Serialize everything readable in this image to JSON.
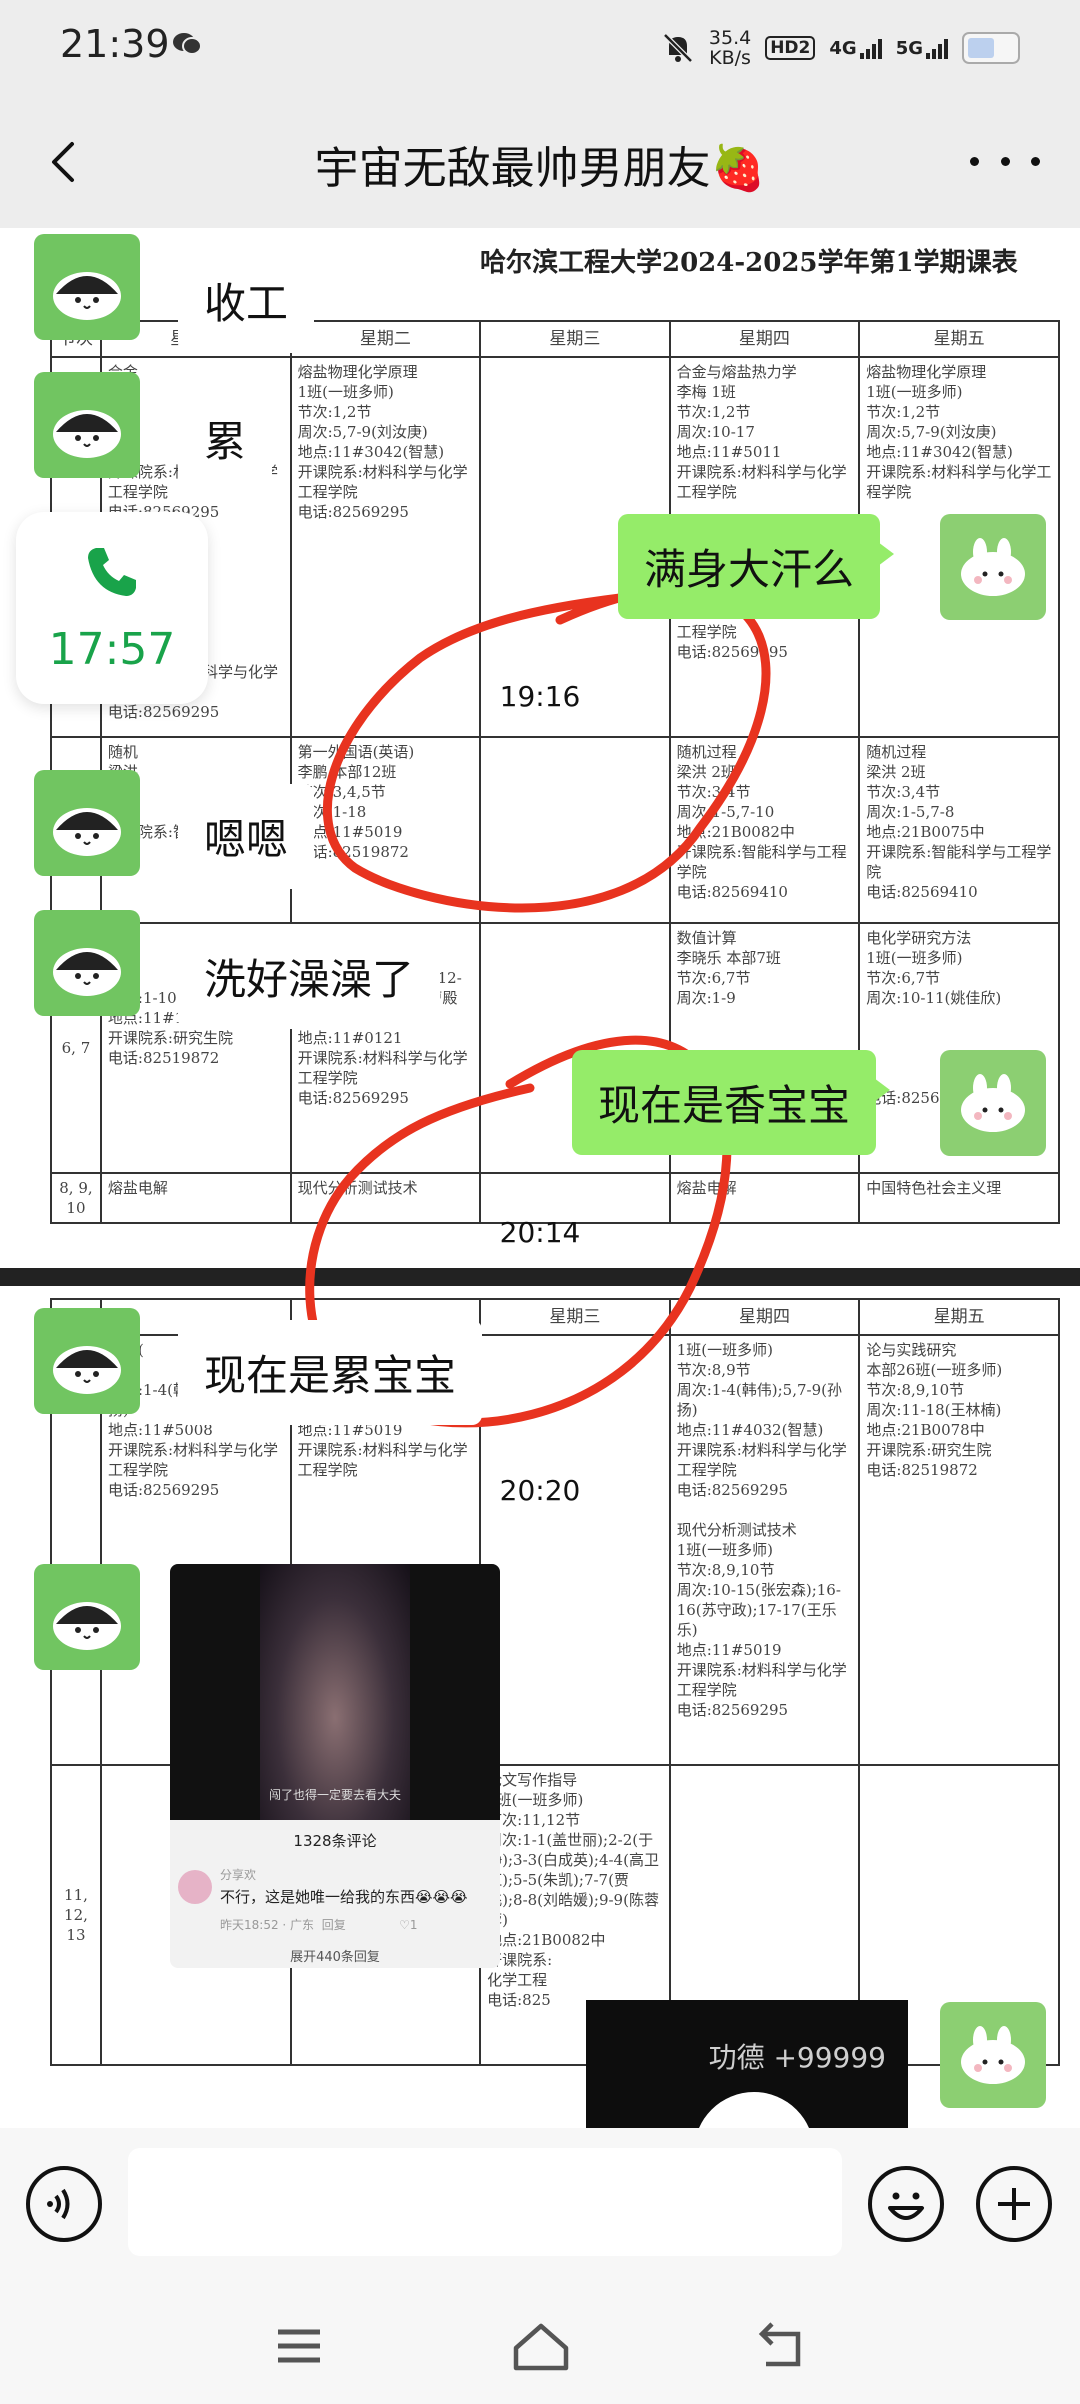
{
  "status_bar": {
    "time": "21:39",
    "speed_value": "35.4",
    "speed_unit": "KB/s",
    "hd_badge": "HD2",
    "net_1": "4G",
    "net_2": "5G",
    "icons": [
      "wechat-icon",
      "mute-icon",
      "signal-icon",
      "battery-icon"
    ]
  },
  "header": {
    "title": "宇宙无敌最帅男朋友🍓",
    "back_icon": "chevron-left-icon",
    "more_icon": "more-dots-icon"
  },
  "schedule": {
    "title": "哈尔滨工程大学2024-2025学年第1学期课表",
    "headers": [
      "节次",
      "星期一",
      "星期二",
      "星期三",
      "星期四",
      "星期五"
    ],
    "rows": [
      {
        "period": "",
        "cells": [
          "合金\n李梅\n1班\n节次\n地点\n开课院系:材料科学与化学工程学院\n电话:82569295\n\n化学原理\n多师)\n节\n(韩伟)\n3042(智\n\n开课院系:材料科学与化学工程学院\n电话:82569295",
          "熔盐物理化学原理\n1班(一班多师)\n节次:1,2节\n周次:5,7-9(刘汝庚)\n地点:11#3042(智慧)\n开课院系:材料科学与化学工程学院\n电话:82569295",
          "",
          "合金与熔盐热力学\n李梅 1班\n节次:1,2节\n周次:10-17\n地点:11#5011\n开课院系:材料科学与化学工程学院\n\n\n\n周次:1-4(韩伟)\n地点:11#3042(智慧)\n开课院系:材料科学与化学工程学院\n电话:82569295",
          "熔盐物理化学原理\n1班(一班多师)\n节次:1,2节\n周次:5,7-9(刘汝庚)\n地点:11#3042(智慧)\n开课院系:材料科学与化学工程学院"
        ]
      },
      {
        "period": "",
        "cells": [
          "随机\n梁洪\n节次\n周次\n开课院系:智能科学与工程学院",
          "第一外国语(英语)\n李鹏 本部12班\n节次:3,4,5节\n周次:1-18\n地点:11#5019\n电话:82519872",
          "",
          "随机过程\n梁洪 2班\n节次:3,4节\n周次:1-5,7-10\n地点:21B0082中\n开课院系:智能科学与工程学院\n电话:82569410",
          "随机过程\n梁洪 2班\n节次:3,4节\n周次:1-5,7-8\n地点:21B0075中\n开课院系:智能科学与工程学院\n电话:82569410"
        ]
      },
      {
        "period": "6, 7",
        "cells": [
          "数值\n李晓\n节次\n周次:1-10\n地点:11#154\n开课院系:研究生院\n电话:82519872",
          "\n\n周次:10-11(姚佳欣);12-12(姚佳欣);13-13(曹殿学);14-17(高胤義)\n地点:11#0121\n开课院系:材料科学与化学工程学院\n电话:82569295",
          "",
          "数值计算\n李晓乐 本部7班\n节次:6,7节\n周次:1-9",
          "电化学研究方法\n1班(一班多师)\n节次:6,7节\n周次:10-11(姚佳欣)\n\n\n\n\n电话:82569295"
        ]
      },
      {
        "period": "8, 9, 10",
        "cells": [
          "熔盐电解",
          "现代分析测试技术",
          "",
          "熔盐电解",
          "中国特色社会主义理"
        ]
      }
    ],
    "headers_2": [
      "",
      "",
      "星期三",
      "星期四",
      "星期五"
    ],
    "rows_2": [
      {
        "period": "",
        "cells": [
          "熔盐(\n节次\n周次:1-4(韩伟);5,7-9(孙扬)\n地点:11#5008\n开课院系:材料科学与化学工程学院\n电话:82569295",
          "\n\n周次:10-15(张宏森);16-16(牛中毅);17-17(孙斌)\n地点:11#5019\n开课院系:材料科学与化学工程学院",
          "",
          "1班(一班多师)\n节次:8,9节\n周次:1-4(韩伟);5,7-9(孙扬)\n地点:11#4032(智慧)\n开课院系:材料科学与化学工程学院\n电话:82569295\n\n现代分析测试技术\n1班(一班多师)\n节次:8,9,10节\n周次:10-15(张宏森);16-16(苏守政);17-17(王乐乐)\n地点:11#5019\n开课院系:材料科学与化学工程学院\n电话:82569295",
          "论与实践研究\n本部26班(一班多师)\n节次:8,9,10节\n周次:11-18(王林楠)\n地点:21B0078中\n开课院系:研究生院\n电话:82519872"
        ]
      },
      {
        "period": "11, 12, 13",
        "cells": [
          "",
          "",
          "论文写作指导\n1班(一班多师)\n节次:11,12节\n周次:1-1(盖世丽);2-2(于静);3-3(白成英);4-4(高卫红);5-5(朱凯);7-7(贾飞);8-8(刘皓媛);9-9(陈蓉蓉)\n地点:21B0082中\n开课院系:\n化学工程\n电话:825",
          "",
          ""
        ]
      }
    ]
  },
  "messages": [
    {
      "side": "in",
      "text": "收工"
    },
    {
      "side": "in",
      "text": "累"
    },
    {
      "side": "out",
      "text": "满身大汗么"
    },
    {
      "side": "in",
      "text": "嗯嗯"
    },
    {
      "side": "in",
      "text": "洗好澡澡了"
    },
    {
      "side": "out",
      "text": "现在是香宝宝"
    },
    {
      "side": "in",
      "text": "现在是累宝宝"
    }
  ],
  "timestamps": [
    "19:16",
    "20:14",
    "20:20"
  ],
  "call_card": {
    "time": "17:57",
    "icon": "phone-icon",
    "color": "#19a34a"
  },
  "video_card": {
    "caption": "闯了也得一定要去看大夫",
    "comment_count": "1328条评论",
    "comment_user": "分享欢",
    "comment_text": "不行，这是她唯一给我的东西😭😭😭",
    "comment_time": "昨天18:52",
    "comment_region": "广东",
    "comment_reply": "回复",
    "comment_likes": "1",
    "expand_label": "展开440条回复"
  },
  "overlay_box": {
    "text": "功德 +99999"
  },
  "input_bar": {
    "voice_icon": "voice-icon",
    "emoji_icon": "emoji-icon",
    "plus_icon": "plus-icon",
    "input_value": ""
  },
  "nav_bar": {
    "icons": [
      "menu-icon",
      "home-icon",
      "back-icon"
    ]
  },
  "colors": {
    "outgoing_bubble": "#95ec69",
    "incoming_bubble": "#ffffff",
    "avatar_green": "#71c561",
    "scribble_red": "#e8331f",
    "call_green": "#19a34a"
  }
}
